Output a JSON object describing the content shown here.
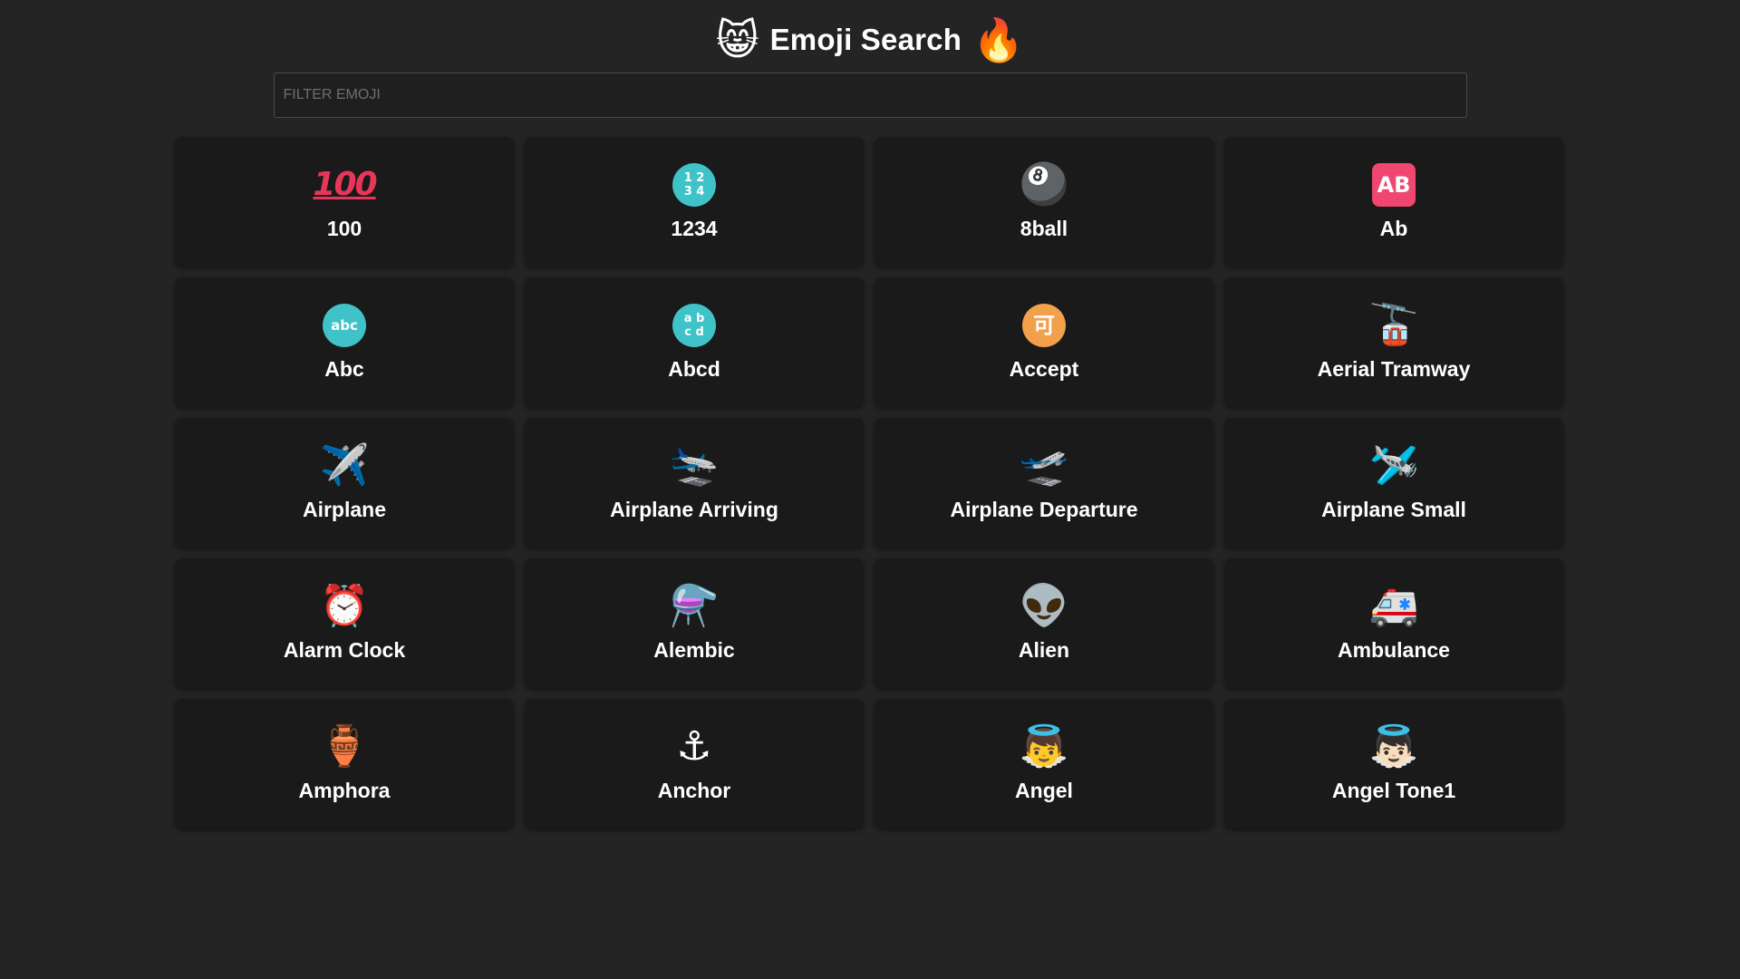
{
  "header": {
    "title": "Emoji Search",
    "left_icon": "😸",
    "right_icon": "🔥"
  },
  "search": {
    "value": "",
    "placeholder": "FILTER EMOJI"
  },
  "cards": [
    {
      "label": "100",
      "glyph": "100",
      "style": "text100",
      "color": "#e8365a"
    },
    {
      "label": "1234",
      "glyph": "1 2\n3 4",
      "style": "badge",
      "color": "#3fc3c9"
    },
    {
      "label": "8ball",
      "glyph": "🎱",
      "style": "emoji"
    },
    {
      "label": "Ab",
      "glyph": "AB",
      "style": "badge-square",
      "color": "#ef476f"
    },
    {
      "label": "Abc",
      "glyph": "abc",
      "style": "badge",
      "color": "#3fc3c9"
    },
    {
      "label": "Abcd",
      "glyph": "a b\nc d",
      "style": "badge",
      "color": "#3fc3c9"
    },
    {
      "label": "Accept",
      "glyph": "可",
      "style": "badge",
      "color": "#f2a04b"
    },
    {
      "label": "Aerial Tramway",
      "glyph": "🚡",
      "style": "emoji"
    },
    {
      "label": "Airplane",
      "glyph": "✈️",
      "style": "emoji"
    },
    {
      "label": "Airplane Arriving",
      "glyph": "🛬",
      "style": "emoji"
    },
    {
      "label": "Airplane Departure",
      "glyph": "🛫",
      "style": "emoji"
    },
    {
      "label": "Airplane Small",
      "glyph": "🛩️",
      "style": "emoji"
    },
    {
      "label": "Alarm Clock",
      "glyph": "⏰",
      "style": "emoji"
    },
    {
      "label": "Alembic",
      "glyph": "⚗️",
      "style": "emoji"
    },
    {
      "label": "Alien",
      "glyph": "👽",
      "style": "emoji"
    },
    {
      "label": "Ambulance",
      "glyph": "🚑",
      "style": "emoji"
    },
    {
      "label": "Amphora",
      "glyph": "🏺",
      "style": "emoji"
    },
    {
      "label": "Anchor",
      "glyph": "⚓",
      "style": "emoji"
    },
    {
      "label": "Angel",
      "glyph": "👼",
      "style": "emoji"
    },
    {
      "label": "Angel Tone1",
      "glyph": "👼🏻",
      "style": "emoji"
    }
  ]
}
